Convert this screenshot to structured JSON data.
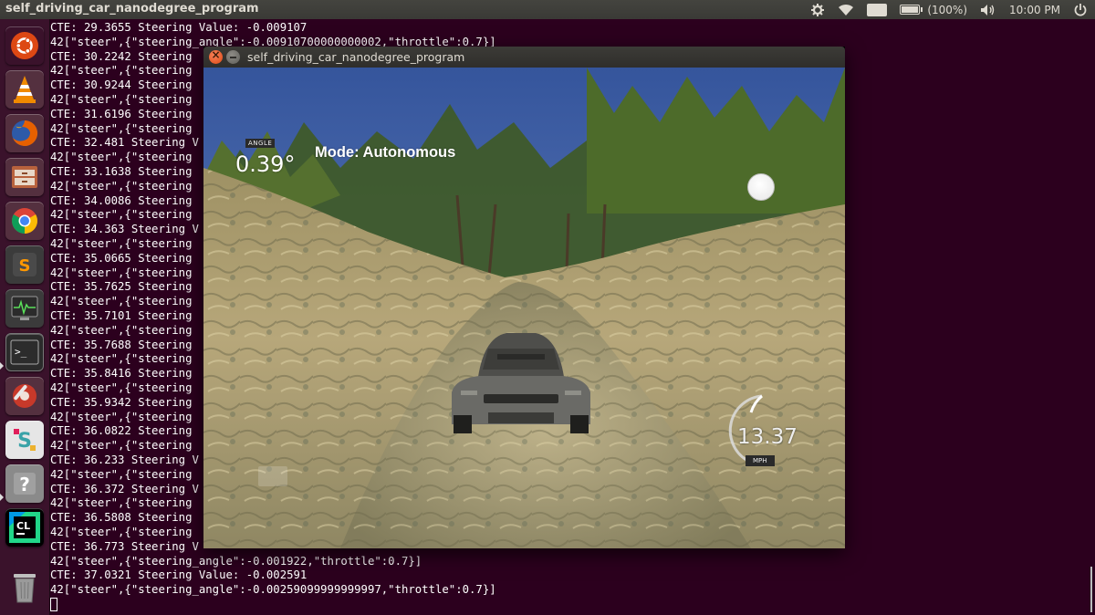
{
  "top_panel": {
    "window_title": "self_driving_car_nanodegree_program",
    "keyboard_layout": "En",
    "battery": "(100%)",
    "battery_level_percent": 100,
    "time": "10:00 PM"
  },
  "launcher": {
    "items": [
      {
        "name": "ubuntu-dash",
        "color": "#dd4814"
      },
      {
        "name": "vlc",
        "color": "#f08a00"
      },
      {
        "name": "firefox",
        "color": "#e66000"
      },
      {
        "name": "files",
        "color": "#b8623d"
      },
      {
        "name": "chrome",
        "color": "#4285f4"
      },
      {
        "name": "sublime-text",
        "color": "#4a4a4a"
      },
      {
        "name": "system-monitor",
        "color": "#3b3b3b"
      },
      {
        "name": "terminal",
        "color": "#2b2b2b"
      },
      {
        "name": "system-settings",
        "color": "#c7392a"
      },
      {
        "name": "slack",
        "color": "#e6e6e6"
      },
      {
        "name": "help",
        "color": "#8a8a8a"
      },
      {
        "name": "clion",
        "color": "#21d789"
      },
      {
        "name": "trash",
        "color": "#6b4a5c"
      }
    ]
  },
  "terminal": {
    "lines": [
      "CTE: 29.3655 Steering Value: -0.009107",
      "42[\"steer\",{\"steering_angle\":-0.00910700000000002,\"throttle\":0.7}]",
      "CTE: 30.2242 Steering",
      "42[\"steer\",{\"steering",
      "CTE: 30.9244 Steering",
      "42[\"steer\",{\"steering",
      "CTE: 31.6196 Steering",
      "42[\"steer\",{\"steering",
      "CTE: 32.481 Steering V",
      "42[\"steer\",{\"steering",
      "CTE: 33.1638 Steering",
      "42[\"steer\",{\"steering",
      "CTE: 34.0086 Steering",
      "42[\"steer\",{\"steering",
      "CTE: 34.363 Steering V",
      "42[\"steer\",{\"steering",
      "CTE: 35.0665 Steering",
      "42[\"steer\",{\"steering",
      "CTE: 35.7625 Steering",
      "42[\"steer\",{\"steering",
      "CTE: 35.7101 Steering",
      "42[\"steer\",{\"steering",
      "CTE: 35.7688 Steering",
      "42[\"steer\",{\"steering",
      "CTE: 35.8416 Steering",
      "42[\"steer\",{\"steering",
      "CTE: 35.9342 Steering",
      "42[\"steer\",{\"steering",
      "CTE: 36.0822 Steering",
      "42[\"steer\",{\"steering",
      "CTE: 36.233 Steering V",
      "42[\"steer\",{\"steering",
      "CTE: 36.372 Steering V",
      "42[\"steer\",{\"steering",
      "CTE: 36.5808 Steering",
      "42[\"steer\",{\"steering",
      "CTE: 36.773 Steering V",
      "42[\"steer\",{\"steering_angle\":-0.001922,\"throttle\":0.7}]",
      "CTE: 37.0321 Steering Value: -0.002591",
      "42[\"steer\",{\"steering_angle\":-0.00259099999999997,\"throttle\":0.7}]"
    ]
  },
  "simulator": {
    "title": "self_driving_car_nanodegree_program",
    "hud": {
      "angle_label": "ANGLE",
      "angle_value": "0.39°",
      "mode": "Mode: Autonomous",
      "speed_value": "13.37",
      "speed_unit": "MPH"
    },
    "colors": {
      "sky": "#3f64ad",
      "terrain": "#b8a77a",
      "trees": "#3f5a23",
      "car": "#5f5f5c"
    }
  }
}
